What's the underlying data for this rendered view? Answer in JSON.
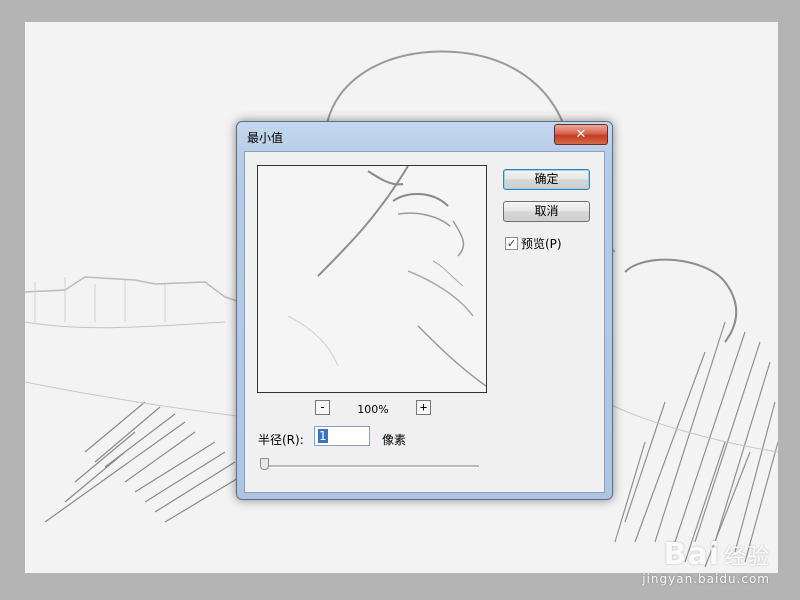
{
  "dialog": {
    "title": "最小值",
    "close_icon": "close-icon"
  },
  "buttons": {
    "ok_label": "确定",
    "cancel_label": "取消"
  },
  "preview_option": {
    "label": "预览(P)",
    "checked": true,
    "check_mark": "✓"
  },
  "zoom": {
    "minus": "-",
    "plus": "+",
    "level": "100%"
  },
  "radius": {
    "label": "半径(R):",
    "value": "1",
    "unit": "像素",
    "slider_fraction": 0.0
  },
  "watermark": {
    "logo": "Bai",
    "logo_suffix": "经验",
    "url": "jingyan.baidu.com"
  },
  "colors": {
    "title_bar": "#b5cbe6",
    "close_button": "#c33d22",
    "selection": "#3476c5"
  }
}
